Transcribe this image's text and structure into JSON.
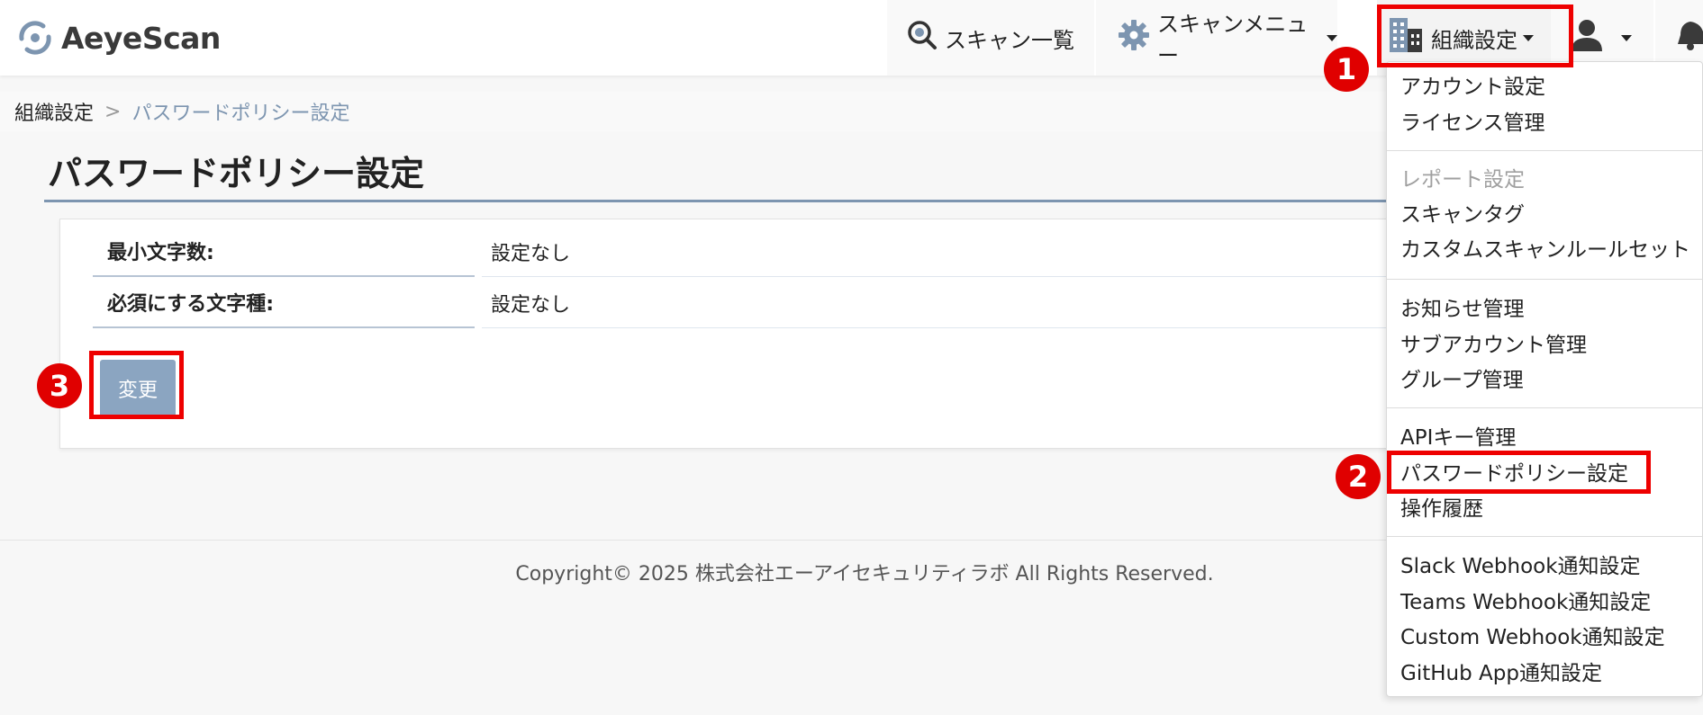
{
  "header": {
    "logo_text": "AeyeScan",
    "nav": {
      "scan_list": "スキャン一覧",
      "scan_menu": "スキャンメニュー",
      "org_settings": "組織設定"
    }
  },
  "breadcrumb": {
    "root": "組織設定",
    "separator": ">",
    "current": "パスワードポリシー設定"
  },
  "page": {
    "title": "パスワードポリシー設定",
    "rows": [
      {
        "label": "最小文字数:",
        "value": "設定なし"
      },
      {
        "label": "必須にする文字種:",
        "value": "設定なし"
      }
    ],
    "change_button": "変更"
  },
  "footer": {
    "copyright": "Copyright© 2025 株式会社エーアイセキュリティラボ All Rights Reserved."
  },
  "dropdown": {
    "items": [
      "アカウント設定",
      "ライセンス管理",
      "レポート設定",
      "スキャンタグ",
      "カスタムスキャンルールセット",
      "お知らせ管理",
      "サブアカウント管理",
      "グループ管理",
      "APIキー管理",
      "パスワードポリシー設定",
      "操作履歴",
      "Slack Webhook通知設定",
      "Teams Webhook通知設定",
      "Custom Webhook通知設定",
      "GitHub App通知設定"
    ]
  },
  "annotations": {
    "badges": [
      "1",
      "2",
      "3"
    ],
    "color": "#e00000"
  },
  "colors": {
    "accent": "#7d95b0",
    "button": "#8ba5c1"
  }
}
